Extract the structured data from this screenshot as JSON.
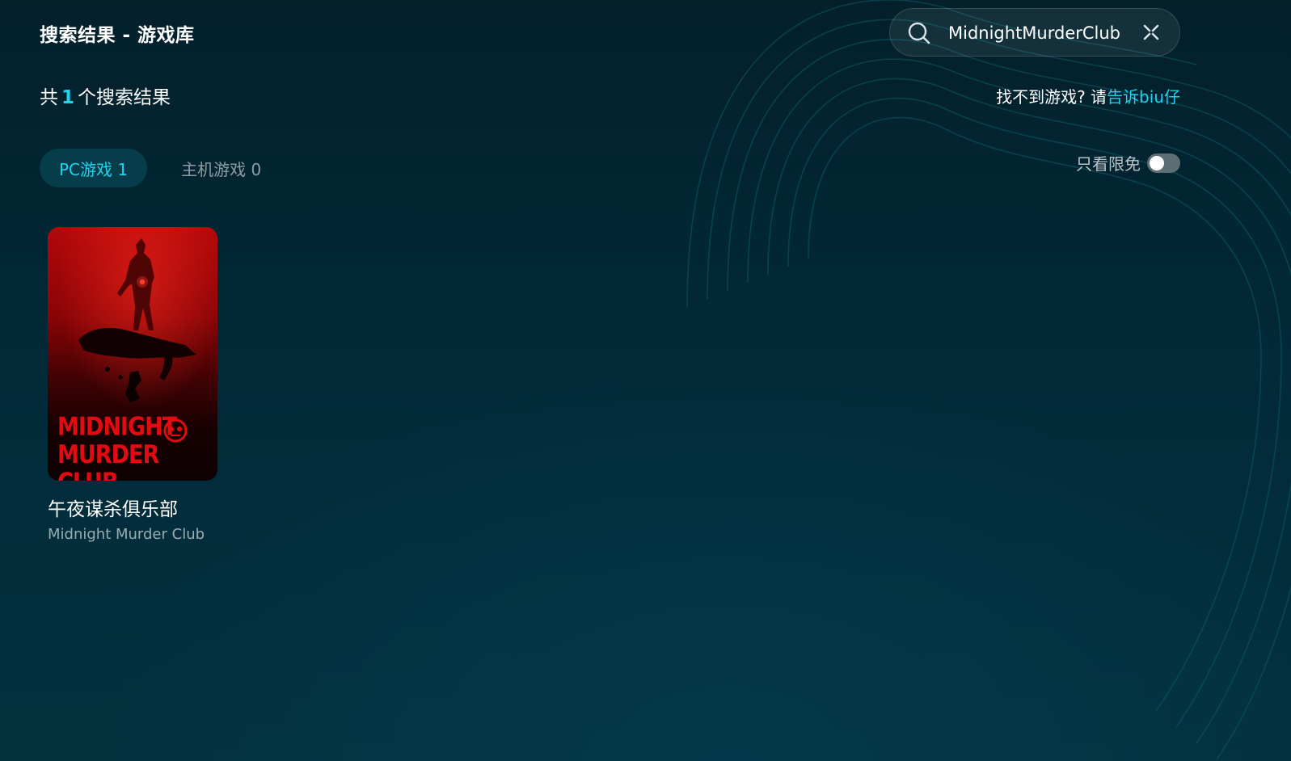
{
  "header": {
    "title": "搜索结果 - 游戏库"
  },
  "search": {
    "value": "MidnightMurderClub",
    "icon": "search-icon",
    "clear_icon": "close-icon"
  },
  "results": {
    "prefix": "共",
    "count": "1",
    "suffix": "个搜索结果"
  },
  "feedback": {
    "text": "找不到游戏? 请",
    "link": "告诉biu仔"
  },
  "tabs": [
    {
      "label": "PC游戏 1",
      "active": true
    },
    {
      "label": "主机游戏 0",
      "active": false
    }
  ],
  "filter": {
    "label": "只看限免",
    "enabled": false
  },
  "games": [
    {
      "name": "午夜谋杀俱乐部",
      "english_name": "Midnight Murder Club",
      "cover_text_line1": "MIDNIGHT",
      "cover_text_line2": "MURDER CLUB"
    }
  ],
  "colors": {
    "accent": "#1ed2f0",
    "background": "#022b3a",
    "active_tab_bg": "#053e4a"
  }
}
